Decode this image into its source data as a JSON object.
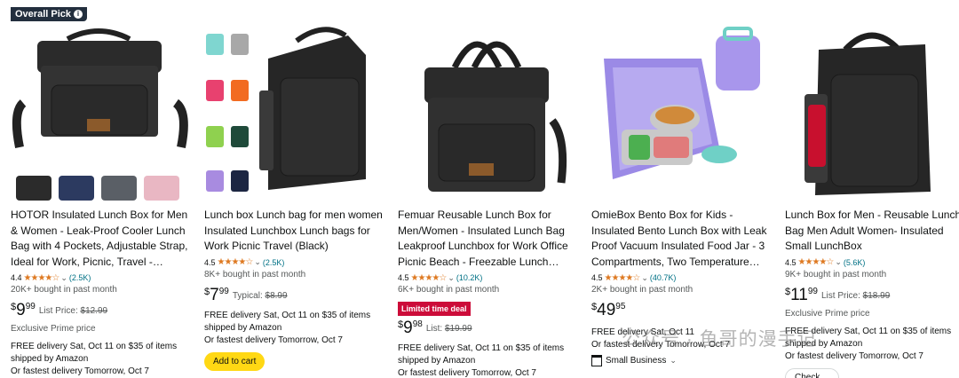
{
  "products": [
    {
      "badge": "Overall Pick",
      "title": "HOTOR Insulated Lunch Box for Men & Women - Leak-Proof Cooler Lunch Bag with 4 Pockets, Adjustable Strap, Ideal for Work, Picnic, Travel -…",
      "rating": "4.4",
      "reviews": "(2.5K)",
      "bought": "20K+ bought in past month",
      "price_whole": "9",
      "price_frac": "99",
      "list_label": "List Price:",
      "list_price": "$12.99",
      "extra": "Exclusive Prime price",
      "delivery": "FREE delivery Sat, Oct 11 on $35 of items shipped by Amazon",
      "fastest": "Or fastest delivery Tomorrow, Oct 7"
    },
    {
      "title": "Lunch box Lunch bag for men women Insulated Lunchbox Lunch bags for Work Picnic Travel (Black)",
      "rating": "4.5",
      "reviews": "(2.5K)",
      "bought": "8K+ bought in past month",
      "price_whole": "7",
      "price_frac": "99",
      "list_label": "Typical:",
      "list_price": "$8.99",
      "delivery": "FREE delivery Sat, Oct 11 on $35 of items shipped by Amazon",
      "fastest": "Or fastest delivery Tomorrow, Oct 7",
      "button": "Add to cart"
    },
    {
      "title": "Femuar Reusable Lunch Box for Men/Women - Insulated Lunch Bag Leakproof Lunchbox for Work Office Picnic Beach - Freezable Lunch Coo…",
      "rating": "4.5",
      "reviews": "(10.2K)",
      "bought": "6K+ bought in past month",
      "deal": "Limited time deal",
      "price_whole": "9",
      "price_frac": "98",
      "list_label": "List:",
      "list_price": "$19.99",
      "delivery": "FREE delivery Sat, Oct 11 on $35 of items shipped by Amazon",
      "fastest": "Or fastest delivery Tomorrow, Oct 7"
    },
    {
      "title": "OmieBox Bento Box for Kids - Insulated Bento Lunch Box with Leak Proof Vacuum Insulated Food Jar - 3 Compartments, Two Temperature…",
      "rating": "4.5",
      "reviews": "(40.7K)",
      "bought": "2K+ bought in past month",
      "price_whole": "49",
      "price_frac": "95",
      "delivery": "FREE delivery Sat, Oct 11",
      "fastest": "Or fastest delivery Tomorrow, Oct 7",
      "small_business": "Small Business"
    },
    {
      "title": "Lunch Box for Men - Reusable Lunch Bag Men Adult Women- Insulated Small LunchBox",
      "rating": "4.5",
      "reviews": "(5.6K)",
      "bought": "9K+ bought in past month",
      "price_whole": "11",
      "price_frac": "99",
      "list_label": "List Price:",
      "list_price": "$18.99",
      "extra": "Exclusive Prime price",
      "delivery": "FREE delivery Sat, Oct 11 on $35 of items shipped by Amazon",
      "fastest": "Or fastest delivery Tomorrow, Oct 7",
      "button": "Check ..."
    }
  ],
  "stars_glyph": "★★★★☆",
  "currency": "$",
  "chevron": "⌄",
  "watermark": "公众号 · 鱼哥的漫手记",
  "colors": {
    "star": "#de7921",
    "link": "#007185",
    "deal": "#cc0c39",
    "button": "#ffd814",
    "badge": "#232f3e",
    "purple": "#9b8ae6"
  }
}
